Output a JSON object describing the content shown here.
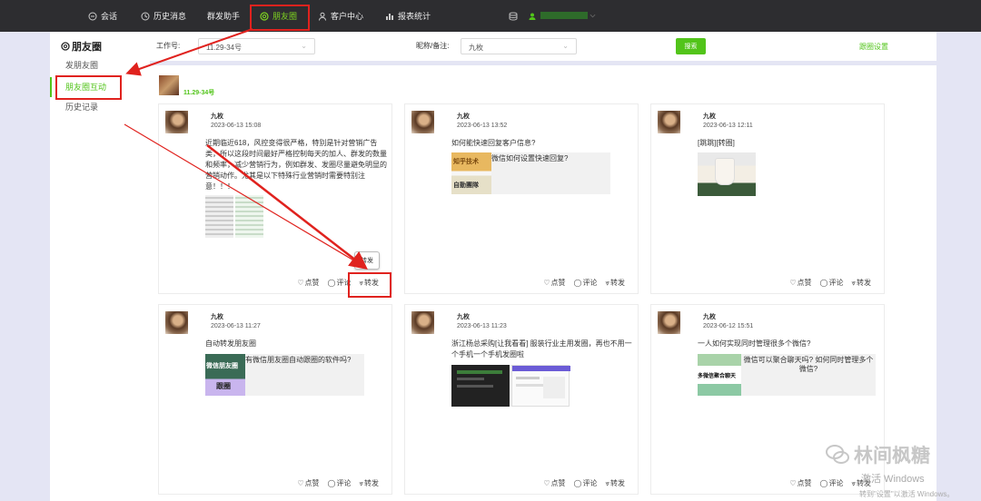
{
  "nav": {
    "items": [
      {
        "label": "会话",
        "icon": "chat-icon"
      },
      {
        "label": "历史消息",
        "icon": "clock-icon"
      },
      {
        "label": "群发助手",
        "icon": ""
      },
      {
        "label": "朋友圈",
        "icon": "aperture-icon"
      },
      {
        "label": "客户中心",
        "icon": "person-icon"
      },
      {
        "label": "报表统计",
        "icon": "bar-chart-icon"
      }
    ],
    "active_index": 3
  },
  "sidebar": {
    "title": "朋友圈",
    "items": [
      {
        "label": "发朋友圈"
      },
      {
        "label": "朋友圈互动"
      },
      {
        "label": "历史记录"
      }
    ],
    "active_index": 1
  },
  "filter": {
    "job_label": "工作号:",
    "job_value": "11.29-34号",
    "nick_label": "昵称/备注:",
    "nick_value": "九枚",
    "search_label": "搜索",
    "settings_label": "跟圈设置"
  },
  "account": {
    "name": "11.29-34号"
  },
  "posts": [
    {
      "name": "九枚",
      "time": "2023-06-13 15:08",
      "text": "近期临近618，风控变得很严格，特别是针对营销广告类，所以这段时间最好严格控制每天的加人、群发的数量和频率，减少营销行为，例如群发、发圈尽量避免明显的营销动作。尤其是以下特殊行业营销时需要特别注意！！！"
    },
    {
      "name": "九枚",
      "time": "2023-06-13 13:52",
      "text": "如何能快速回复客户信息?",
      "link": "微信如何设置快速回复?",
      "thumb_top": "知乎技术",
      "thumb_bottom": "自動團隊"
    },
    {
      "name": "九枚",
      "time": "2023-06-13 12:11",
      "text": "[跳跳][转圈]"
    },
    {
      "name": "九枚",
      "time": "2023-06-13 11:27",
      "text": "自动转发朋友圈",
      "link": "有微信朋友圈自动跟圈的软件吗?",
      "thumb_top": "微信朋友圈",
      "thumb_bottom": "跟圈"
    },
    {
      "name": "九枚",
      "time": "2023-06-13 11:23",
      "text": "浙江杨总采购[让我看看] 服装行业主用发圈，再也不用一个手机一个手机发圈啦"
    },
    {
      "name": "九枚",
      "time": "2023-06-12 15:51",
      "text": "一人如何实现同时管理很多个微信?",
      "link": "微信可以聚合聊天吗? 如何同时管理多个微信?",
      "thumb_text": "多微信聚合聊天"
    }
  ],
  "actions": {
    "like": "点赞",
    "comment": "评论",
    "share": "转发"
  },
  "tooltip": "转发",
  "watermark": "林间枫糖",
  "activation": {
    "line1": "激活 Windows",
    "line2": "转到\"设置\"以激活 Windows。"
  },
  "colors": {
    "accent": "#52c41a",
    "nav_bg": "#2d2d30",
    "highlight": "#e0221e"
  }
}
